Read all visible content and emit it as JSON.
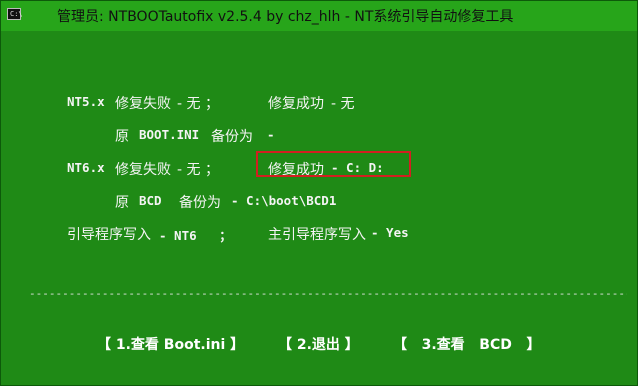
{
  "window": {
    "title": "管理员:  NTBOOTautofix v2.5.4 by chz_hlh - NT系统引导自动修复工具",
    "icon_label": "C:\\",
    "icon": "console-window-icon"
  },
  "console": {
    "nt5_label": "NT5.x",
    "nt5_fail_label": "修复失败",
    "nt5_fail_value": "- 无 ；",
    "nt5_success_label": "修复成功",
    "nt5_success_value": "- 无",
    "boot_ini_prefix": "原",
    "boot_ini_name": "BOOT.INI",
    "boot_ini_backup_label": "备份为",
    "boot_ini_backup_value": "-",
    "nt6_label": "NT6.x",
    "nt6_fail_label": "修复失败",
    "nt6_fail_value": "- 无 ；",
    "nt6_success_label": "修复成功",
    "nt6_success_value": "- C: D:",
    "bcd_prefix": "原",
    "bcd_name": "BCD",
    "bcd_backup_label": "备份为",
    "bcd_backup_value": "- C:\\boot\\BCD1",
    "loader_label": "引导程序写入",
    "loader_value": "- NT6   ；",
    "main_loader_label": "主引导程序写入",
    "main_loader_value": "- Yes",
    "separator": "----------------------------------------------------------------------------------------------------",
    "buttons": {
      "view_boot_ini": "【 1.查看 Boot.ini 】",
      "exit": "【 2.退出 】",
      "view_bcd": "【   3.查看   BCD   】"
    }
  },
  "colors": {
    "background": "#1f8a16",
    "titlebar": "#27a51a",
    "highlight": "#d22020"
  }
}
